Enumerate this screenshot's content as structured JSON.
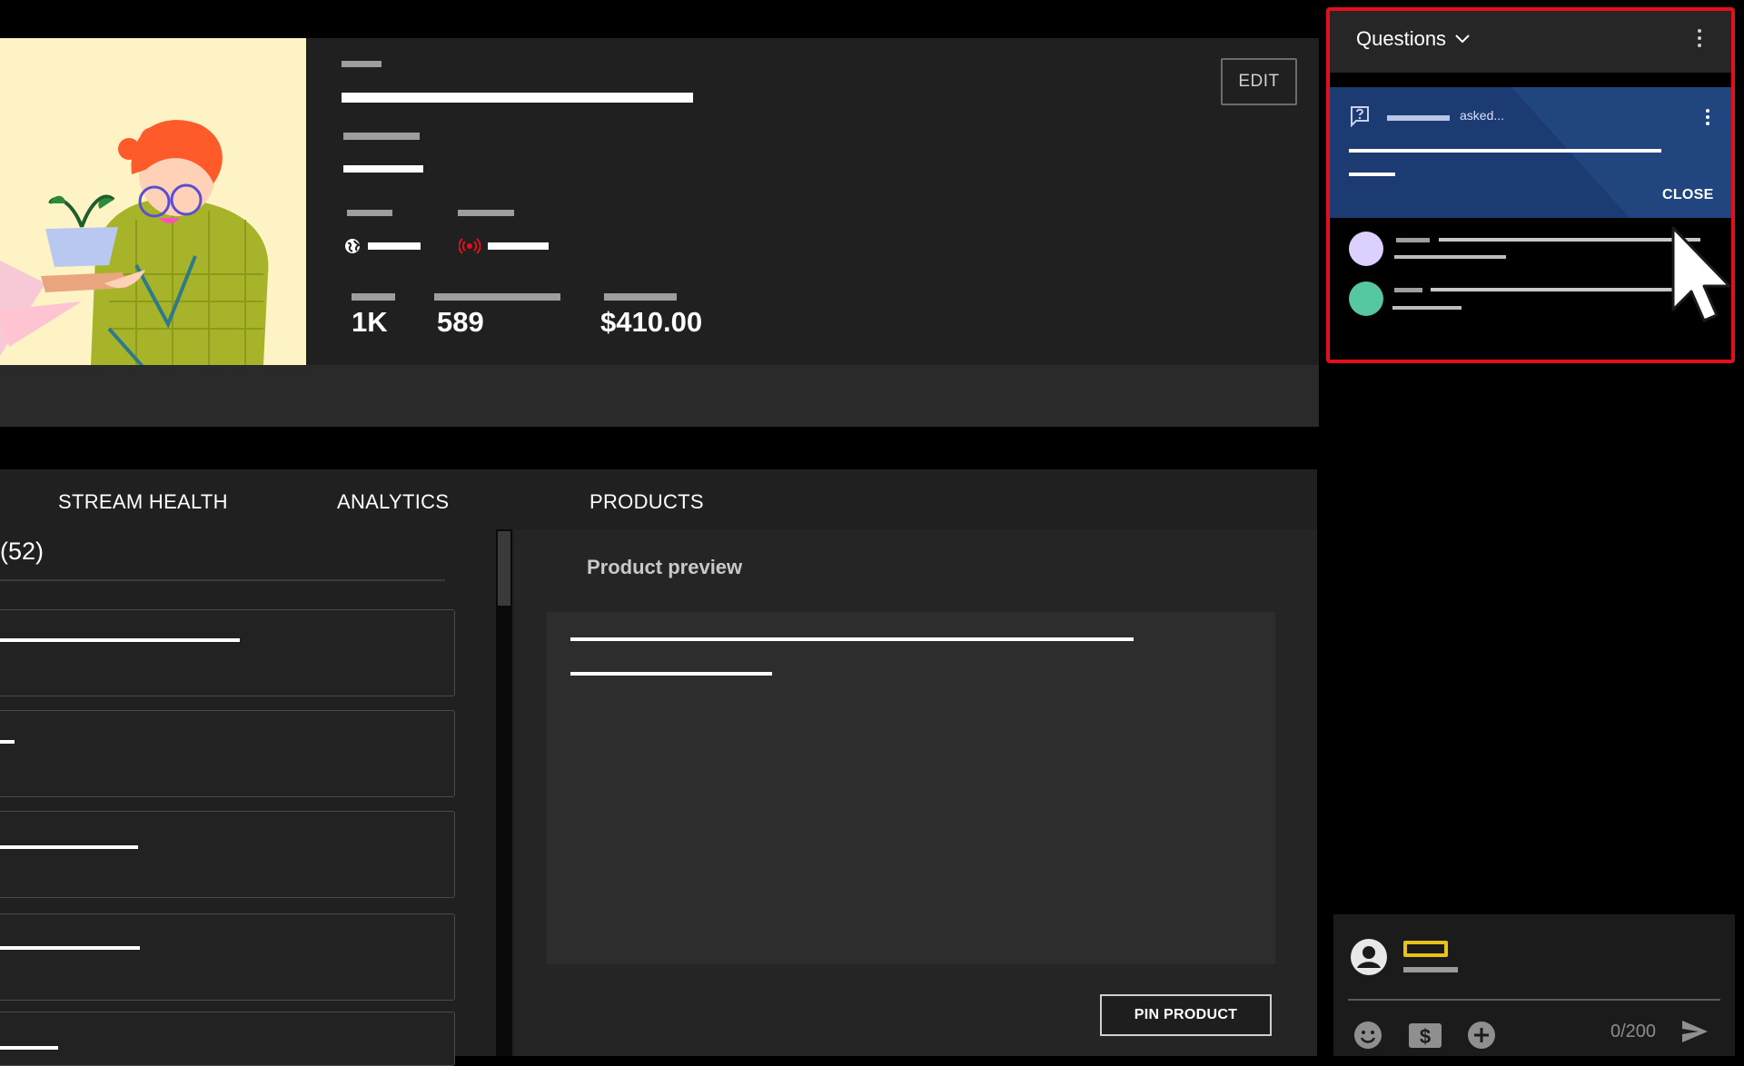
{
  "stream": {
    "edit_label": "EDIT",
    "stats": [
      {
        "value": "1K"
      },
      {
        "value": "589"
      },
      {
        "value": "$410.00"
      }
    ]
  },
  "tabs": [
    {
      "label": "STREAM HEALTH",
      "active": false
    },
    {
      "label": "ANALYTICS",
      "active": false
    },
    {
      "label": "PRODUCTS",
      "active": true
    }
  ],
  "products": {
    "left_title": "(52)",
    "preview_title": "Product preview",
    "pin_label": "PIN PRODUCT"
  },
  "questions_panel": {
    "title": "Questions",
    "card": {
      "asked_text": "asked...",
      "close_label": "CLOSE"
    },
    "avatars": [
      {
        "color": "#dcd0ff"
      },
      {
        "color": "#56c7a0"
      }
    ]
  },
  "chat": {
    "counter": "0/200"
  },
  "colors": {
    "question_card": "#1c3b72",
    "highlight_border": "#e3101b",
    "live_icon": "#e3101b",
    "chat_badge": "#e6c21a"
  }
}
